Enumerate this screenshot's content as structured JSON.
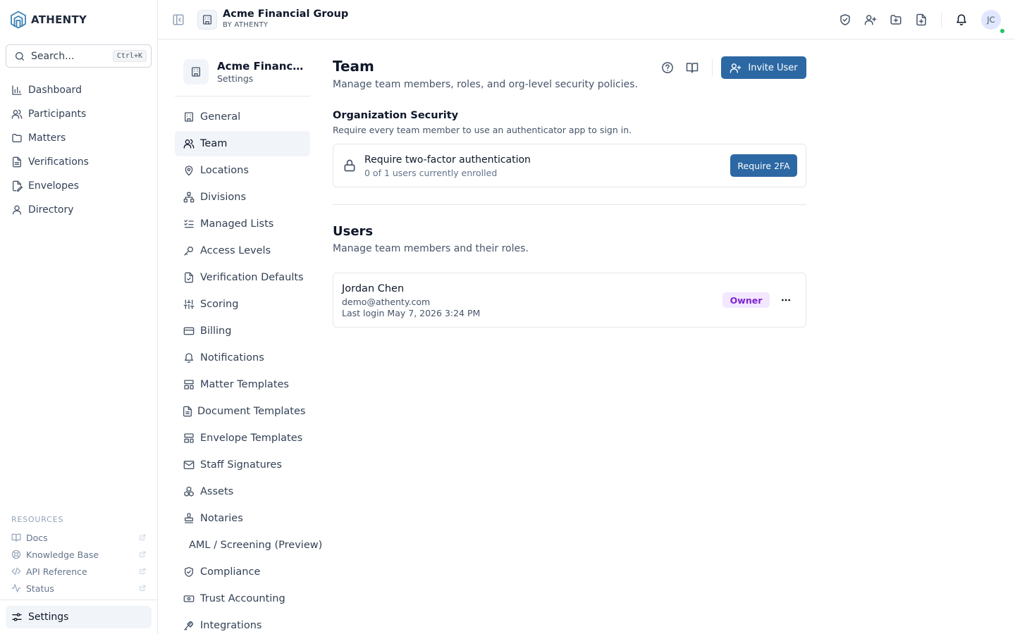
{
  "brand": {
    "name": "ATHENTY",
    "logo_icon": "athenty-logo-icon"
  },
  "search": {
    "placeholder": "Search...",
    "shortcut": "Ctrl+K"
  },
  "nav": {
    "items": [
      {
        "label": "Dashboard",
        "icon": "bar-chart-icon"
      },
      {
        "label": "Participants",
        "icon": "users-icon"
      },
      {
        "label": "Matters",
        "icon": "folder-icon"
      },
      {
        "label": "Verifications",
        "icon": "file-text-icon"
      },
      {
        "label": "Envelopes",
        "icon": "file-signature-icon"
      },
      {
        "label": "Directory",
        "icon": "user-icon"
      }
    ]
  },
  "resources": {
    "label": "RESOURCES",
    "items": [
      {
        "label": "Docs",
        "icon": "book-icon"
      },
      {
        "label": "Knowledge Base",
        "icon": "life-buoy-icon"
      },
      {
        "label": "API Reference",
        "icon": "code-icon"
      },
      {
        "label": "Status",
        "icon": "activity-icon"
      }
    ]
  },
  "sidebar_settings": {
    "label": "Settings",
    "icon": "sliders-icon"
  },
  "header": {
    "org_name": "Acme Financial Group",
    "org_by": "BY ATHENTY",
    "avatar_initials": "JC"
  },
  "settings_panel": {
    "org_name": "Acme Financial Group",
    "subtitle": "Settings",
    "items": [
      {
        "label": "General",
        "icon": "building-icon",
        "active": false
      },
      {
        "label": "Team",
        "icon": "users-icon",
        "active": true
      },
      {
        "label": "Locations",
        "icon": "map-pin-icon",
        "active": false
      },
      {
        "label": "Divisions",
        "icon": "network-icon",
        "active": false
      },
      {
        "label": "Managed Lists",
        "icon": "list-checks-icon",
        "active": false
      },
      {
        "label": "Access Levels",
        "icon": "key-icon",
        "active": false
      },
      {
        "label": "Verification Defaults",
        "icon": "file-check-icon",
        "active": false
      },
      {
        "label": "Scoring",
        "icon": "sliders-vertical-icon",
        "active": false
      },
      {
        "label": "Billing",
        "icon": "credit-card-icon",
        "active": false
      },
      {
        "label": "Notifications",
        "icon": "bell-icon",
        "active": false
      },
      {
        "label": "Matter Templates",
        "icon": "layout-template-icon",
        "active": false
      },
      {
        "label": "Document Templates",
        "icon": "file-icon",
        "active": false
      },
      {
        "label": "Envelope Templates",
        "icon": "layout-template-icon",
        "active": false
      },
      {
        "label": "Staff Signatures",
        "icon": "mail-icon",
        "active": false
      },
      {
        "label": "Assets",
        "icon": "boxes-icon",
        "active": false
      },
      {
        "label": "Notaries",
        "icon": "stamp-icon",
        "active": false
      },
      {
        "label": "AML / Screening (Preview)",
        "icon": "",
        "active": false
      },
      {
        "label": "Compliance",
        "icon": "shield-check-icon",
        "active": false
      },
      {
        "label": "Trust Accounting",
        "icon": "banknote-icon",
        "active": false
      },
      {
        "label": "Integrations",
        "icon": "plug-icon",
        "active": false
      }
    ]
  },
  "team": {
    "title": "Team",
    "description": "Manage team members, roles, and org-level security policies.",
    "invite_label": "Invite User",
    "security": {
      "title": "Organization Security",
      "description": "Require every team member to use an authenticator app to sign in.",
      "twofa_title": "Require two-factor authentication",
      "twofa_status": "0 of 1 users currently enrolled",
      "twofa_button": "Require 2FA"
    },
    "users": {
      "title": "Users",
      "description": "Manage team members and their roles.",
      "list": [
        {
          "name": "Jordan Chen",
          "email": "demo@athenty.com",
          "last_login": "Last login May 7, 2026 3:24 PM",
          "role": "Owner"
        }
      ]
    }
  },
  "colors": {
    "primary": "#2c68a3",
    "owner_badge_bg": "#f3e8ff",
    "owner_badge_text": "#7e22ce",
    "online": "#22c55e"
  }
}
